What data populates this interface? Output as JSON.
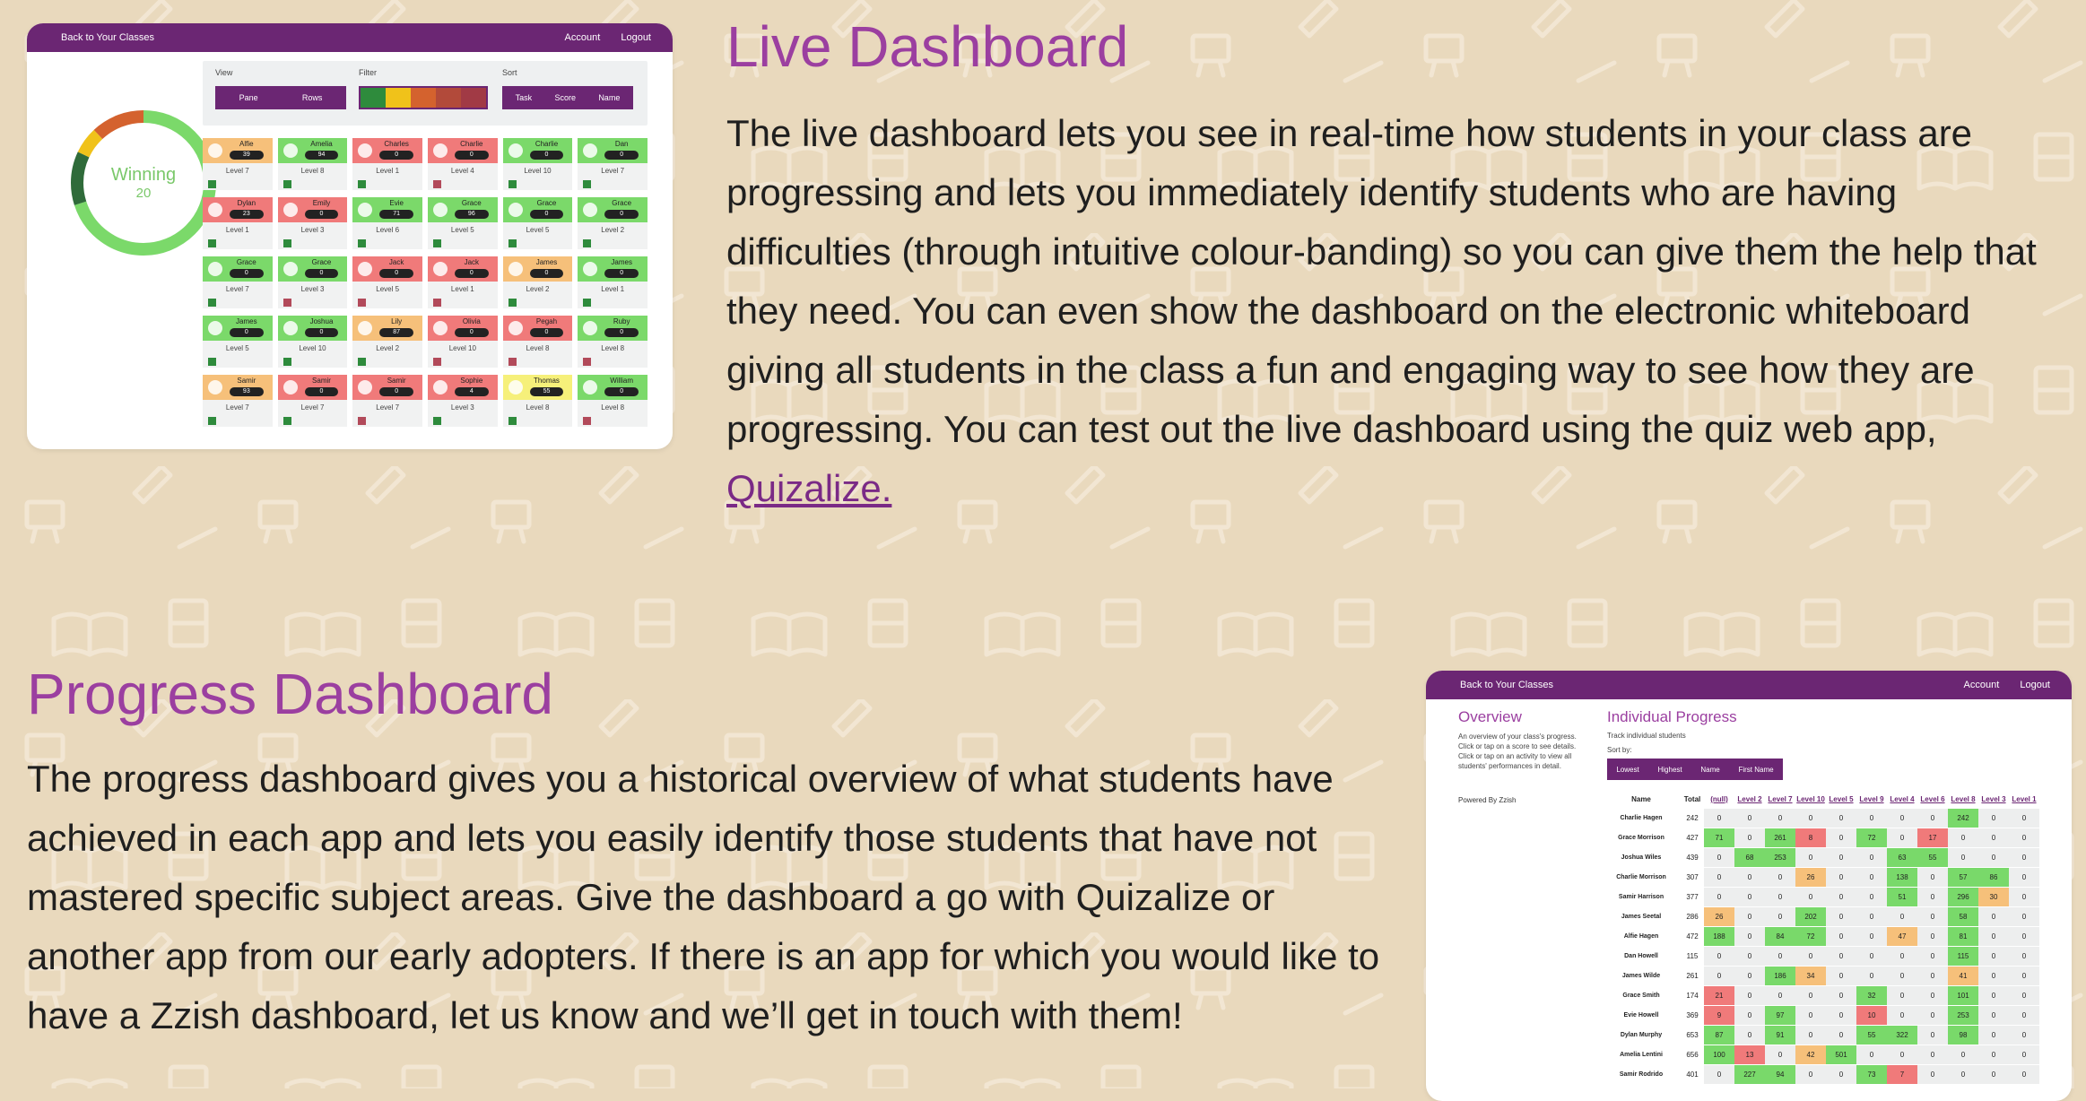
{
  "live": {
    "title": "Live Dashboard",
    "body_text": "The live dashboard lets you see in real-time how students in your class are progressing and lets you immediately identify students who are having difficulties (through intuitive colour-banding) so you can give them the help that they need. You can even show the dashboard on the electronic whiteboard giving all students in the class a fun and engaging way to see how they are progressing. You can test out the live dashboard using the quiz web app, ",
    "link_text": "Quizalize.",
    "card": {
      "back_link": "Back to Your Classes",
      "account": "Account",
      "logout": "Logout",
      "view_label": "View",
      "view_options": [
        "Pane",
        "Rows"
      ],
      "filter_label": "Filter",
      "filter_colors": [
        "#2e8b3c",
        "#f0c21a",
        "#d4622e",
        "#b24a3a",
        "#a13a45"
      ],
      "sort_label": "Sort",
      "sort_options": [
        "Task",
        "Score",
        "Name"
      ],
      "donut_label": "Winning",
      "donut_value": "20",
      "donut_segments": [
        {
          "color": "#7bd96a",
          "fraction": 0.7
        },
        {
          "color": "#2f6b3a",
          "fraction": 0.12
        },
        {
          "color": "#f0c21a",
          "fraction": 0.06
        },
        {
          "color": "#d4622e",
          "fraction": 0.12
        }
      ],
      "tiles": [
        {
          "name": "Alfie",
          "score": "39",
          "level": "Level 7",
          "color": "#f6c07a",
          "square": "#2e8b3c"
        },
        {
          "name": "Amelia",
          "score": "94",
          "level": "Level 8",
          "color": "#7bd96a",
          "square": "#2e8b3c"
        },
        {
          "name": "Charles",
          "score": "0",
          "level": "Level 1",
          "color": "#f07a7a",
          "square": "#2e8b3c"
        },
        {
          "name": "Charlie",
          "score": "0",
          "level": "Level 4",
          "color": "#f07a7a",
          "square": "#b24a5a"
        },
        {
          "name": "Charlie",
          "score": "0",
          "level": "Level 10",
          "color": "#7bd96a",
          "square": "#2e8b3c"
        },
        {
          "name": "Dan",
          "score": "0",
          "level": "Level 7",
          "color": "#7bd96a",
          "square": "#2e8b3c"
        },
        {
          "name": "Dylan",
          "score": "23",
          "level": "Level 1",
          "color": "#f07a7a",
          "square": "#2e8b3c"
        },
        {
          "name": "Emily",
          "score": "0",
          "level": "Level 3",
          "color": "#f07a7a",
          "square": "#2e8b3c"
        },
        {
          "name": "Evie",
          "score": "71",
          "level": "Level 6",
          "color": "#7bd96a",
          "square": "#2e8b3c"
        },
        {
          "name": "Grace",
          "score": "96",
          "level": "Level 5",
          "color": "#7bd96a",
          "square": "#2e8b3c"
        },
        {
          "name": "Grace",
          "score": "0",
          "level": "Level 5",
          "color": "#7bd96a",
          "square": "#2e8b3c"
        },
        {
          "name": "Grace",
          "score": "0",
          "level": "Level 2",
          "color": "#7bd96a",
          "square": "#2e8b3c"
        },
        {
          "name": "Grace",
          "score": "0",
          "level": "Level 7",
          "color": "#7bd96a",
          "square": "#2e8b3c"
        },
        {
          "name": "Grace",
          "score": "0",
          "level": "Level 3",
          "color": "#7bd96a",
          "square": "#b24a5a"
        },
        {
          "name": "Jack",
          "score": "0",
          "level": "Level 5",
          "color": "#f07a7a",
          "square": "#b24a5a"
        },
        {
          "name": "Jack",
          "score": "0",
          "level": "Level 1",
          "color": "#f07a7a",
          "square": "#b24a5a"
        },
        {
          "name": "James",
          "score": "0",
          "level": "Level 2",
          "color": "#f6c07a",
          "square": "#2e8b3c"
        },
        {
          "name": "James",
          "score": "0",
          "level": "Level 1",
          "color": "#7bd96a",
          "square": "#2e8b3c"
        },
        {
          "name": "James",
          "score": "0",
          "level": "Level 5",
          "color": "#7bd96a",
          "square": "#2e8b3c"
        },
        {
          "name": "Joshua",
          "score": "0",
          "level": "Level 10",
          "color": "#7bd96a",
          "square": "#2e8b3c"
        },
        {
          "name": "Lily",
          "score": "87",
          "level": "Level 2",
          "color": "#f6c07a",
          "square": "#2e8b3c"
        },
        {
          "name": "Olivia",
          "score": "0",
          "level": "Level 10",
          "color": "#f07a7a",
          "square": "#b24a5a"
        },
        {
          "name": "Pegah",
          "score": "0",
          "level": "Level 8",
          "color": "#f07a7a",
          "square": "#b24a5a"
        },
        {
          "name": "Ruby",
          "score": "0",
          "level": "Level 8",
          "color": "#7bd96a",
          "square": "#b24a5a"
        },
        {
          "name": "Samir",
          "score": "93",
          "level": "Level 7",
          "color": "#f6c07a",
          "square": "#2e8b3c"
        },
        {
          "name": "Samir",
          "score": "0",
          "level": "Level 7",
          "color": "#f07a7a",
          "square": "#2e8b3c"
        },
        {
          "name": "Samir",
          "score": "0",
          "level": "Level 7",
          "color": "#f07a7a",
          "square": "#b24a5a"
        },
        {
          "name": "Sophie",
          "score": "4",
          "level": "Level 3",
          "color": "#f07a7a",
          "square": "#2e8b3c"
        },
        {
          "name": "Thomas",
          "score": "55",
          "level": "Level 8",
          "color": "#f6f07a",
          "square": "#2e8b3c"
        },
        {
          "name": "William",
          "score": "0",
          "level": "Level 8",
          "color": "#7bd96a",
          "square": "#b24a5a"
        }
      ]
    }
  },
  "progress": {
    "title": "Progress Dashboard",
    "body_text": "The progress dashboard gives you a historical overview of what students have achieved in each app and lets you easily identify those students that have not mastered specific subject areas. Give the dashboard a go with Quizalize or another app from our early adopters. If there is an app for which you would like to have a Zzish dashboard, let us know and we’ll get in touch with them!",
    "card": {
      "back_link": "Back to Your Classes",
      "account": "Account",
      "logout": "Logout",
      "overview_title": "Overview",
      "overview_desc": "An overview of your class's progress. Click or tap on a score to see details. Click or tap on an activity to view all students' performances in detail.",
      "powered_by": "Powered By Zzish",
      "ip_title": "Individual Progress",
      "ip_sub": "Track individual students",
      "sort_label": "Sort by:",
      "sort_options": [
        "Lowest",
        "Highest",
        "Name",
        "First Name"
      ],
      "columns": [
        "Name",
        "Total",
        "(null)",
        "Level 2",
        "Level 7",
        "Level 10",
        "Level 5",
        "Level 9",
        "Level 4",
        "Level 6",
        "Level 8",
        "Level 3",
        "Level 1"
      ],
      "rows": [
        {
          "name": "Charlie Hagen",
          "total": "242",
          "cells": [
            "0",
            "0",
            "0",
            "0",
            "0",
            "0",
            "0",
            "0",
            "242",
            "0",
            "0"
          ],
          "colors": [
            "",
            "",
            "",
            "",
            "",
            "",
            "",
            "",
            "g",
            "",
            ""
          ]
        },
        {
          "name": "Grace Morrison",
          "total": "427",
          "cells": [
            "71",
            "0",
            "261",
            "8",
            "0",
            "72",
            "0",
            "17",
            "0",
            "0",
            "0"
          ],
          "colors": [
            "g",
            "",
            "g",
            "r",
            "",
            "g",
            "",
            "r",
            "",
            "",
            ""
          ]
        },
        {
          "name": "Joshua Wiles",
          "total": "439",
          "cells": [
            "0",
            "68",
            "253",
            "0",
            "0",
            "0",
            "63",
            "55",
            "0",
            "0",
            "0"
          ],
          "colors": [
            "",
            "g",
            "g",
            "",
            "",
            "",
            "g",
            "g",
            "",
            "",
            ""
          ]
        },
        {
          "name": "Charlie Morrison",
          "total": "307",
          "cells": [
            "0",
            "0",
            "0",
            "26",
            "0",
            "0",
            "138",
            "0",
            "57",
            "86",
            "0"
          ],
          "colors": [
            "",
            "",
            "",
            "o",
            "",
            "",
            "g",
            "",
            "g",
            "g",
            ""
          ]
        },
        {
          "name": "Samir Harrison",
          "total": "377",
          "cells": [
            "0",
            "0",
            "0",
            "0",
            "0",
            "0",
            "51",
            "0",
            "296",
            "30",
            "0"
          ],
          "colors": [
            "",
            "",
            "",
            "",
            "",
            "",
            "g",
            "",
            "g",
            "o",
            ""
          ]
        },
        {
          "name": "James Seetal",
          "total": "286",
          "cells": [
            "26",
            "0",
            "0",
            "202",
            "0",
            "0",
            "0",
            "0",
            "58",
            "0",
            "0"
          ],
          "colors": [
            "o",
            "",
            "",
            "g",
            "",
            "",
            "",
            "",
            "g",
            "",
            ""
          ]
        },
        {
          "name": "Alfie Hagen",
          "total": "472",
          "cells": [
            "188",
            "0",
            "84",
            "72",
            "0",
            "0",
            "47",
            "0",
            "81",
            "0",
            "0"
          ],
          "colors": [
            "g",
            "",
            "g",
            "g",
            "",
            "",
            "o",
            "",
            "g",
            "",
            ""
          ]
        },
        {
          "name": "Dan Howell",
          "total": "115",
          "cells": [
            "0",
            "0",
            "0",
            "0",
            "0",
            "0",
            "0",
            "0",
            "115",
            "0",
            "0"
          ],
          "colors": [
            "",
            "",
            "",
            "",
            "",
            "",
            "",
            "",
            "g",
            "",
            ""
          ]
        },
        {
          "name": "James Wilde",
          "total": "261",
          "cells": [
            "0",
            "0",
            "186",
            "34",
            "0",
            "0",
            "0",
            "0",
            "41",
            "0",
            "0"
          ],
          "colors": [
            "",
            "",
            "g",
            "o",
            "",
            "",
            "",
            "",
            "o",
            "",
            ""
          ]
        },
        {
          "name": "Grace Smith",
          "total": "174",
          "cells": [
            "21",
            "0",
            "0",
            "0",
            "0",
            "32",
            "0",
            "0",
            "101",
            "0",
            "0"
          ],
          "colors": [
            "r",
            "",
            "",
            "",
            "",
            "g",
            "",
            "",
            "g",
            "",
            ""
          ]
        },
        {
          "name": "Evie Howell",
          "total": "369",
          "cells": [
            "9",
            "0",
            "97",
            "0",
            "0",
            "10",
            "0",
            "0",
            "253",
            "0",
            "0"
          ],
          "colors": [
            "r",
            "",
            "g",
            "",
            "",
            "r",
            "",
            "",
            "g",
            "",
            ""
          ]
        },
        {
          "name": "Dylan Murphy",
          "total": "653",
          "cells": [
            "87",
            "0",
            "91",
            "0",
            "0",
            "55",
            "322",
            "0",
            "98",
            "0",
            "0"
          ],
          "colors": [
            "g",
            "",
            "g",
            "",
            "",
            "g",
            "g",
            "",
            "g",
            "",
            ""
          ]
        },
        {
          "name": "Amelia Lentini",
          "total": "656",
          "cells": [
            "100",
            "13",
            "0",
            "42",
            "501",
            "0",
            "0",
            "0",
            "0",
            "0",
            "0"
          ],
          "colors": [
            "g",
            "r",
            "",
            "o",
            "g",
            "",
            "",
            "",
            "",
            "",
            ""
          ]
        },
        {
          "name": "Samir Rodrido",
          "total": "401",
          "cells": [
            "0",
            "227",
            "94",
            "0",
            "0",
            "73",
            "7",
            "0",
            "0",
            "0",
            "0"
          ],
          "colors": [
            "",
            "g",
            "g",
            "",
            "",
            "g",
            "r",
            "",
            "",
            "",
            ""
          ]
        }
      ]
    }
  }
}
